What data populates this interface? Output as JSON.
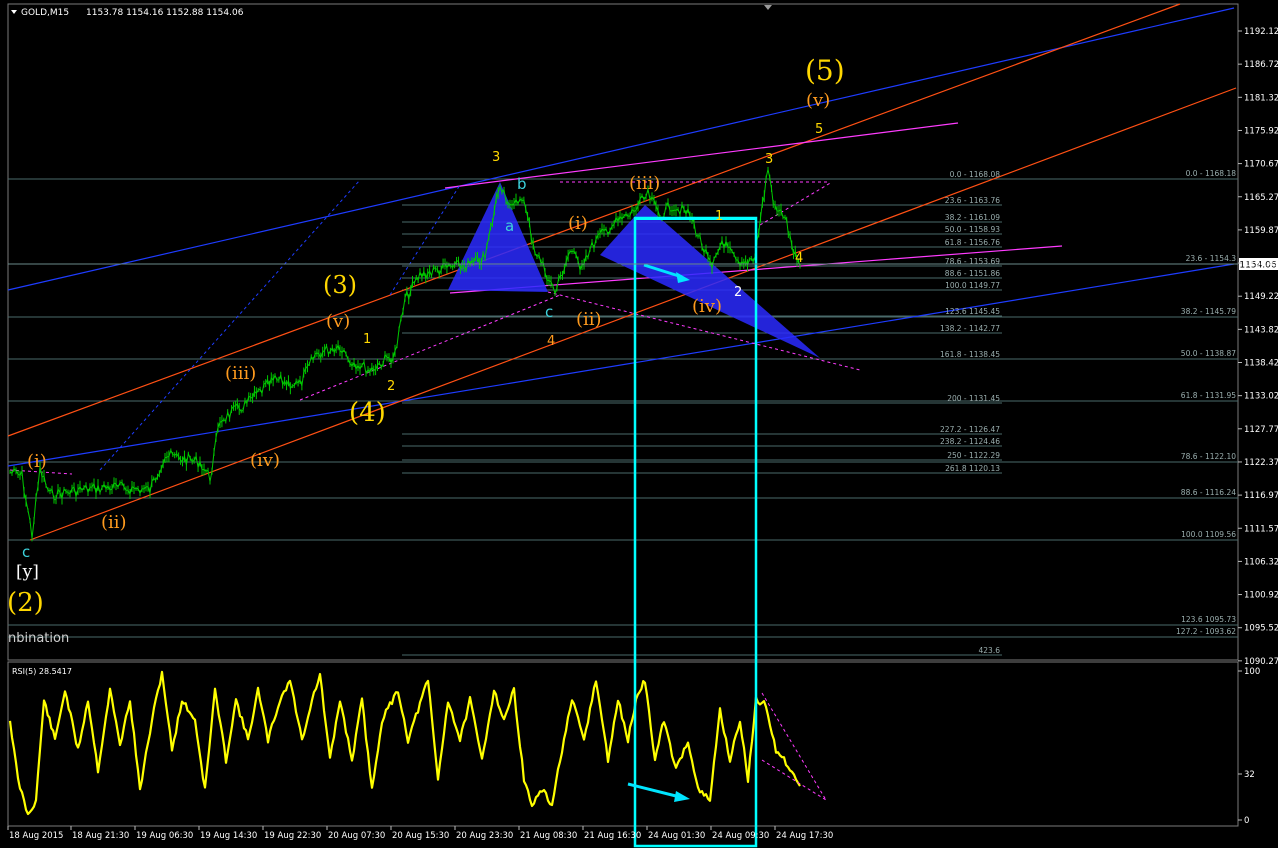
{
  "header": {
    "symbol_timeframe": "GOLD,M15",
    "ohlc": "1153.78 1154.16 1152.88 1154.06"
  },
  "price_axis": {
    "ticks": [
      "1192.12",
      "1186.72",
      "1181.32",
      "1175.92",
      "1170.67",
      "1165.27",
      "1159.87",
      "1154.47",
      "1149.22",
      "1143.82",
      "1138.42",
      "1133.02",
      "1127.77",
      "1122.37",
      "1116.97",
      "1111.57",
      "1106.32",
      "1100.92",
      "1095.52",
      "1090.27"
    ],
    "current_price": "1154.06"
  },
  "rsi_panel": {
    "title": "RSI(5) 28.5417",
    "ticks": [
      "100",
      "32",
      "0"
    ]
  },
  "time_axis": {
    "ticks": [
      "18 Aug 2015",
      "18 Aug 21:30",
      "19 Aug 06:30",
      "19 Aug 14:30",
      "19 Aug 22:30",
      "20 Aug 07:30",
      "20 Aug 15:30",
      "20 Aug 23:30",
      "21 Aug 08:30",
      "21 Aug 16:30",
      "24 Aug 01:30",
      "24 Aug 09:30",
      "24 Aug 17:30"
    ]
  },
  "fib_left": [
    {
      "text": "0.0 - 1168.08"
    },
    {
      "text": "23.6 - 1163.76"
    },
    {
      "text": "38.2 - 1161.09"
    },
    {
      "text": "50.0 - 1158.93"
    },
    {
      "text": "61.8 - 1156.76"
    },
    {
      "text": "78.6 - 1153.69"
    },
    {
      "text": "88.6 - 1151.86"
    },
    {
      "text": "100.0 1149.77"
    },
    {
      "text": "123.6 1145.45"
    },
    {
      "text": "138.2 - 1142.77"
    },
    {
      "text": "161.8 - 1138.45"
    },
    {
      "text": "200 - 1131.45"
    },
    {
      "text": "227.2 - 1126.47"
    },
    {
      "text": "238.2 - 1124.46"
    },
    {
      "text": "250 - 1122.29"
    },
    {
      "text": "261.8 1120.13"
    },
    {
      "text": "423.6"
    }
  ],
  "fib_right": [
    {
      "text": "0.0 - 1168.18"
    },
    {
      "text": "23.6 - 1154.3"
    },
    {
      "text": "38.2 - 1145.79"
    },
    {
      "text": "50.0 - 1138.87"
    },
    {
      "text": "61.8 - 1131.95"
    },
    {
      "text": "78.6 - 1122.10"
    },
    {
      "text": "88.6 - 1116.24"
    },
    {
      "text": "100.0 1109.56"
    },
    {
      "text": "123.6 1095.73"
    },
    {
      "text": "127.2 - 1093.62"
    }
  ],
  "wave_labels": {
    "five_big": "(5)",
    "v_top": "(v)",
    "five_small": "5",
    "three_left": "3",
    "three_right": "3",
    "b": "b",
    "a": "a",
    "c_mid": "c",
    "iii_top": "(iii)",
    "i_mid": "(i)",
    "ii_mid": "(ii)",
    "iv_mid": "(iv)",
    "one_right": "1",
    "two_right": "2",
    "four_right": "4",
    "four_mid": "4",
    "three_big": "(3)",
    "v_left": "(v)",
    "one_left": "1",
    "two_left": "2",
    "iii_left": "(iii)",
    "four_big": "(4)",
    "iv_left": "(iv)",
    "i_left": "(i)",
    "ii_left": "(ii)",
    "c_left": "c",
    "y_left": "[y]",
    "two_big": "(2)",
    "combination": "nbination"
  },
  "colors": {
    "background": "#000000",
    "candles": "#00c800",
    "rsi_line": "#ffff00",
    "wave_orange": "#ff9b1e",
    "wave_yellow": "#ffd700",
    "wave_cyan": "#3cd2dc",
    "channel_blue": "#1e3cff",
    "channel_orange": "#ff5014",
    "magenta": "#ff3cff",
    "triangle_blue": "#2a2aff",
    "highlight_box": "#00ffff",
    "fib_line": "#4a6a6a",
    "axis_text": "#ffffff"
  },
  "chart_data": {
    "type": "line",
    "title": "GOLD,M15",
    "series": [
      {
        "name": "GOLD,M15",
        "x": [
          "18 Aug 2015",
          "18 Aug 21:30",
          "19 Aug 06:30",
          "19 Aug 14:30",
          "19 Aug 22:30",
          "20 Aug 07:30",
          "20 Aug 15:30",
          "20 Aug 23:30",
          "21 Aug 08:30",
          "21 Aug 16:30",
          "24 Aug 01:30",
          "24 Aug 09:30",
          "24 Aug 17:30"
        ],
        "values": [
          1116,
          1115,
          1118,
          1126,
          1133,
          1137,
          1152,
          1166,
          1150,
          1159,
          1163,
          1152,
          1154
        ]
      },
      {
        "name": "RSI(5)",
        "values": [
          55,
          60,
          50,
          55,
          70,
          60,
          65,
          45,
          55,
          70,
          50,
          75,
          30
        ]
      }
    ],
    "ylim": [
      1090.27,
      1192.12
    ],
    "rsi_ylim": [
      0,
      100
    ],
    "grid": false
  }
}
